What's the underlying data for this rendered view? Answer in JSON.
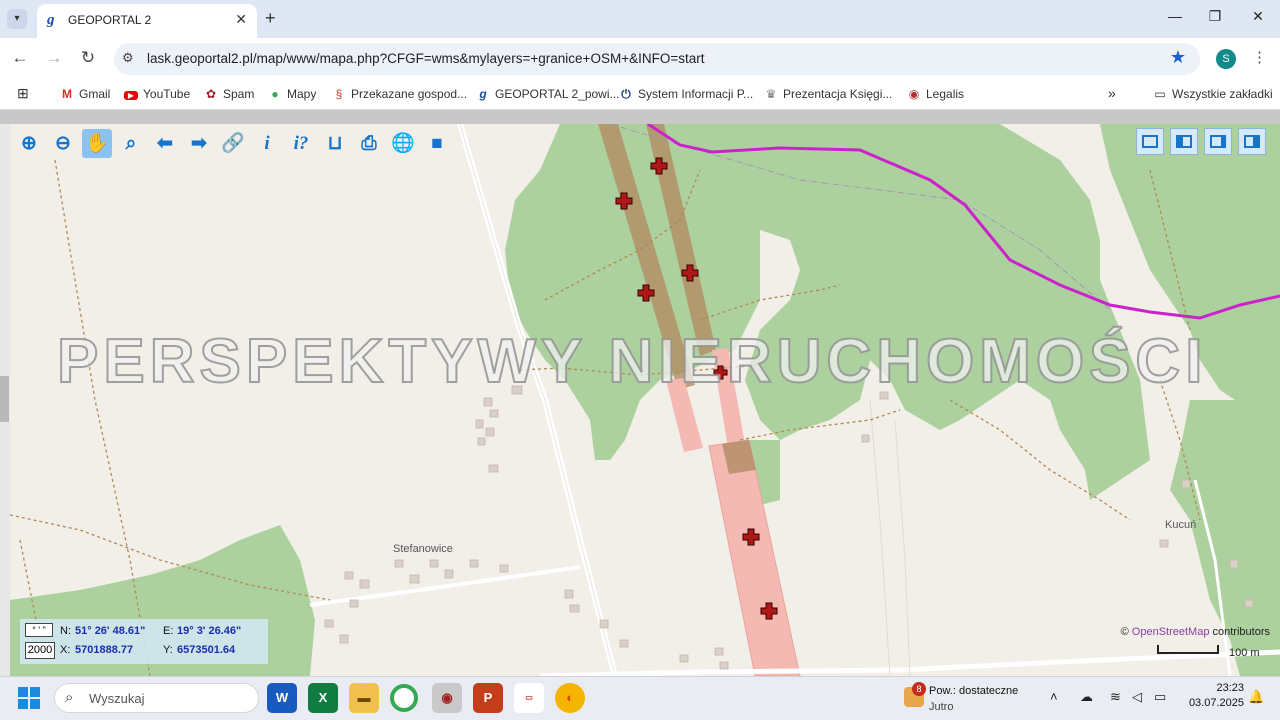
{
  "browser": {
    "tab_title": "GEOPORTAL 2",
    "tab_favicon": "g",
    "url": "lask.geoportal2.pl/map/www/mapa.php?CFGF=wms&mylayers=+granice+OSM+&INFO=start",
    "profile_initial": "S",
    "bookmarks": [
      {
        "icon": "gmail-icon",
        "label": "Gmail"
      },
      {
        "icon": "youtube-icon",
        "label": "YouTube"
      },
      {
        "icon": "spam-icon",
        "label": "Spam"
      },
      {
        "icon": "maps-icon",
        "label": "Mapy"
      },
      {
        "icon": "paragraph-icon",
        "label": "Przekazane gospod..."
      },
      {
        "icon": "geoportal-icon",
        "label": "GEOPORTAL 2_powi..."
      },
      {
        "icon": "power-icon",
        "label": "System Informacji P..."
      },
      {
        "icon": "eagle-icon",
        "label": "Prezentacja Księgi..."
      },
      {
        "icon": "legalis-icon",
        "label": "Legalis"
      }
    ],
    "all_bookmarks": "Wszystkie zakładki"
  },
  "map": {
    "watermark": "PERSPEKTYWY NIERUCHOMOŚCI",
    "places": {
      "village1": "Stefanowice",
      "village2": "Kucuń"
    },
    "coords": {
      "format_label": "° ' \"",
      "scale_value": "2000",
      "n_label": "N:",
      "n_value": "51° 26' 48.61\"",
      "e_label": "E:",
      "e_value": "19° 3' 26.46\"",
      "x_label": "X:",
      "x_value": "5701888.77",
      "y_label": "Y:",
      "y_value": "6573501.64"
    },
    "attribution": {
      "prefix": "©",
      "link": "OpenStreetMap",
      "suffix": "contributors"
    },
    "scale_label": "100 m",
    "tools": [
      "zoom-in-icon",
      "zoom-out-icon",
      "pan-hand-icon",
      "zoom-box-icon",
      "back-arrow-icon",
      "forward-arrow-icon",
      "link-icon",
      "info-icon",
      "info-query-icon",
      "measure-icon",
      "print-icon",
      "globe-icon",
      "camera-icon"
    ]
  },
  "colors": {
    "forest": "#add19e",
    "boundary": "#cc22cc",
    "parcel_pink": "#f3b9b2",
    "parcel_brown": "#b08c62",
    "marker": "#b01818"
  },
  "taskbar": {
    "search_placeholder": "Wyszukaj",
    "weather_badge": "8",
    "weather_line1": "Pow.: dostateczne",
    "weather_line2": "Jutro",
    "time": "23:23",
    "date": "03.07.2025"
  }
}
